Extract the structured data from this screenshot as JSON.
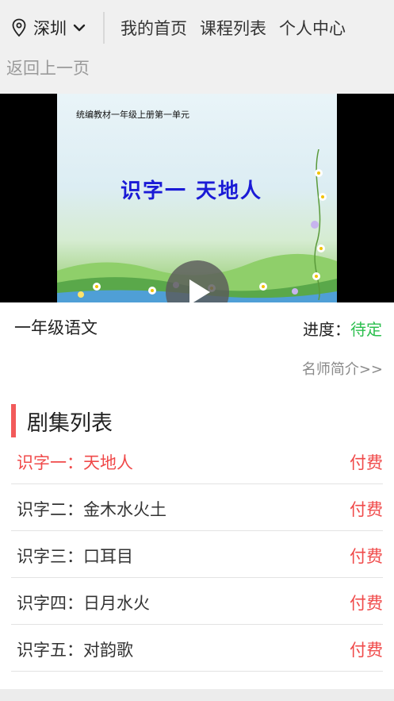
{
  "header": {
    "city": "深圳",
    "nav": [
      "我的首页",
      "课程列表",
      "个人中心"
    ]
  },
  "back_label": "返回上一页",
  "video": {
    "slide_subtitle": "统编教材一年级上册第一单元",
    "slide_title": "识字一 天地人"
  },
  "course": {
    "title": "一年级语文",
    "progress_label": "进度：",
    "progress_value": "待定",
    "teacher_link": "名师简介>>"
  },
  "episodes": {
    "section_title": "剧集列表",
    "items": [
      {
        "title": "识字一：天地人",
        "price": "付费"
      },
      {
        "title": "识字二：金木水火土",
        "price": "付费"
      },
      {
        "title": "识字三：口耳目",
        "price": "付费"
      },
      {
        "title": "识字四：日月水火",
        "price": "付费"
      },
      {
        "title": "识字五：对韵歌",
        "price": "付费"
      }
    ]
  },
  "colors": {
    "accent_red": "#f04a4a",
    "progress_green": "#2bbf4e"
  },
  "icons": {
    "location": "location-pin-icon",
    "dropdown": "chevron-down-icon",
    "play": "play-icon"
  }
}
